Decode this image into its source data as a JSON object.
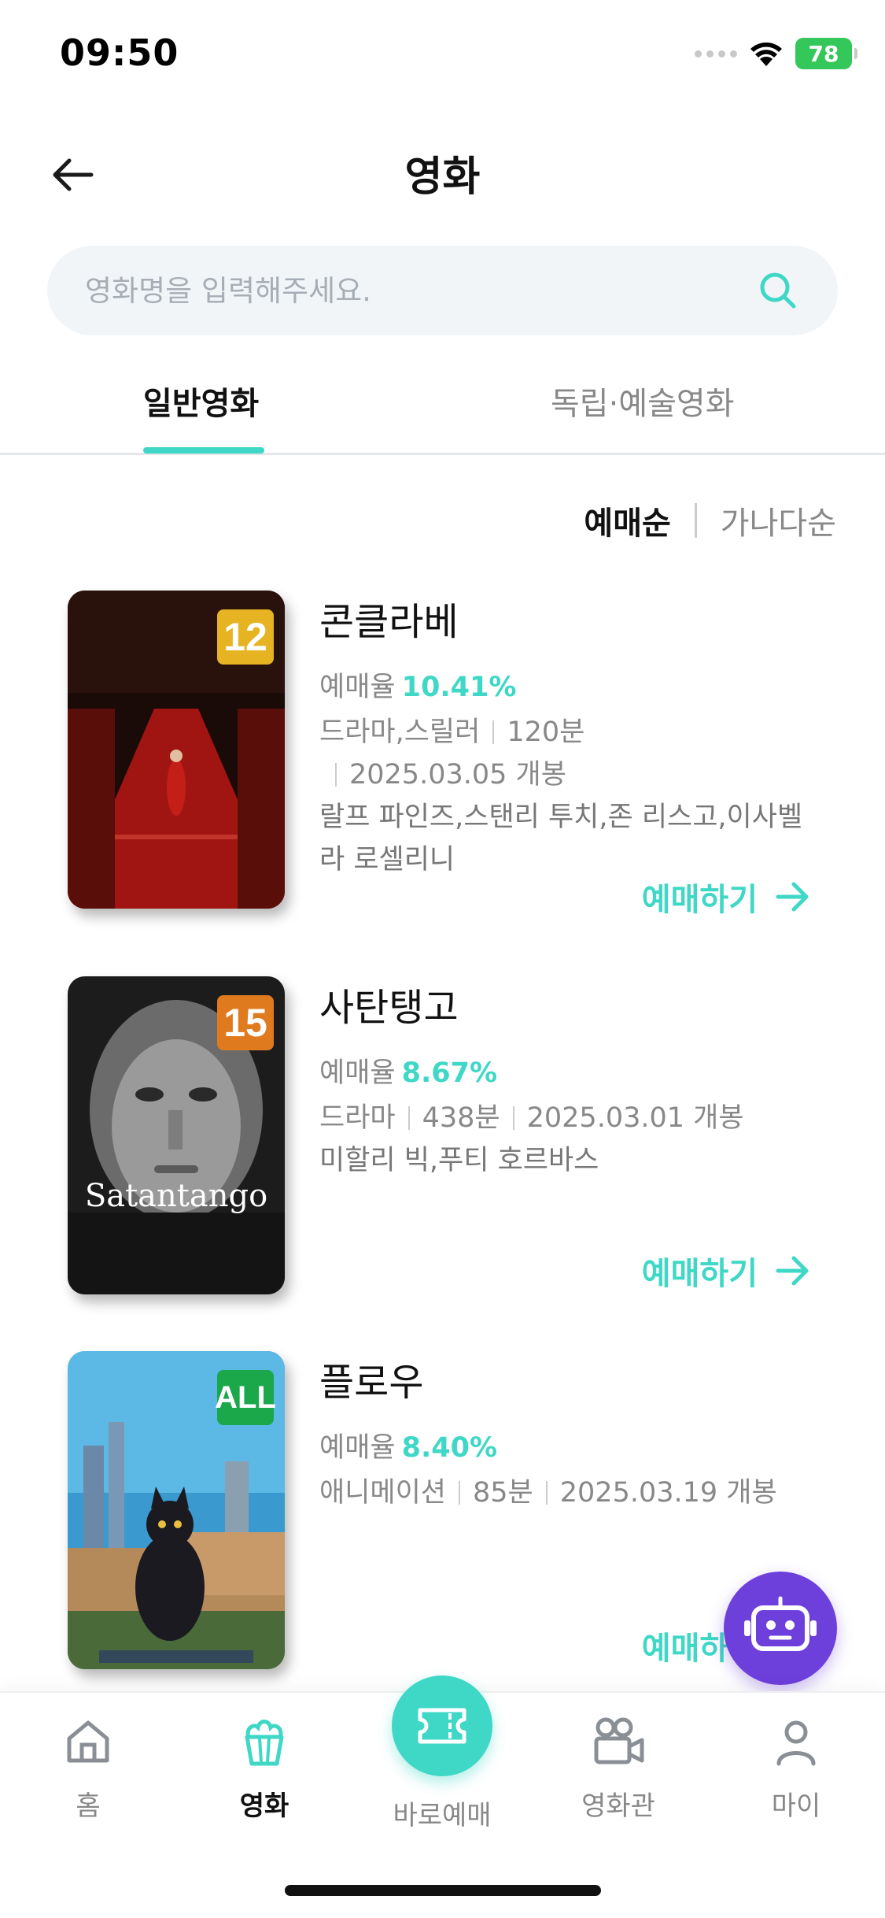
{
  "status_bar": {
    "time": "09:50",
    "battery": "78"
  },
  "header": {
    "title": "영화"
  },
  "search": {
    "placeholder": "영화명을 입력해주세요."
  },
  "tabs": [
    {
      "label": "일반영화",
      "active": true
    },
    {
      "label": "독립·예술영화",
      "active": false
    }
  ],
  "sort": {
    "options": [
      "예매순",
      "가나다순"
    ],
    "active": "예매순"
  },
  "movies": [
    {
      "title": "콘클라베",
      "rating": "12",
      "rating_color": "#e6b422",
      "rate_label": "예매율",
      "rate": "10.41%",
      "genre": "드라마,스릴러",
      "runtime": "120분",
      "release": "2025.03.05 개봉",
      "cast": "랄프 파인즈,스탠리 투치,존 리스고,이사벨",
      "cast_line2": "라 로셀리니",
      "book_label": "예매하기"
    },
    {
      "title": "사탄탱고",
      "rating": "15",
      "rating_color": "#e07a1f",
      "rate_label": "예매율",
      "rate": "8.67%",
      "genre": "드라마",
      "runtime": "438분",
      "release": "2025.03.01 개봉",
      "cast": "미할리 빅,푸티 호르바스",
      "book_label": "예매하기"
    },
    {
      "title": "플로우",
      "rating": "ALL",
      "rating_color": "#1aa84b",
      "rate_label": "예매율",
      "rate": "8.40%",
      "genre": "애니메이션",
      "runtime": "85분",
      "release": "2025.03.19 개봉",
      "book_label": "예매하기"
    }
  ],
  "bottom_nav": [
    {
      "label": "홈",
      "icon": "home-icon"
    },
    {
      "label": "영화",
      "icon": "popcorn-icon",
      "active": true
    },
    {
      "label": "바로예매",
      "icon": "ticket-icon"
    },
    {
      "label": "영화관",
      "icon": "camera-icon"
    },
    {
      "label": "마이",
      "icon": "person-icon"
    }
  ],
  "colors": {
    "accent": "#3fd7c6",
    "chatbot": "#6d3fdb"
  }
}
